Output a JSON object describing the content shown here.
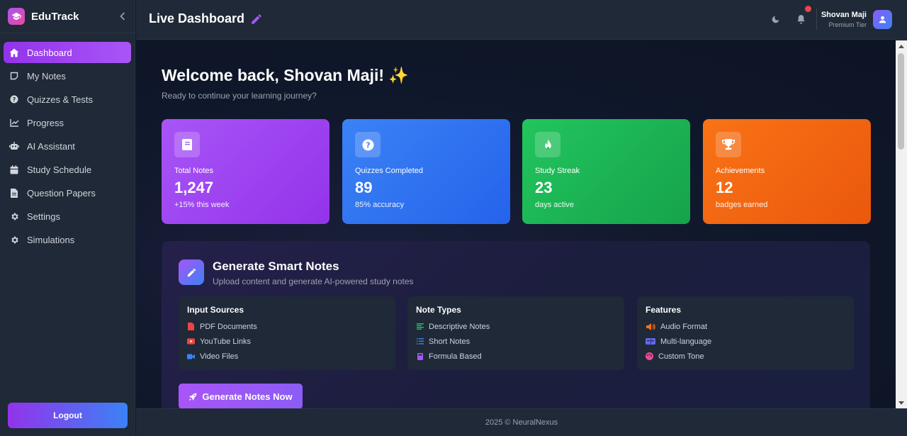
{
  "app": {
    "name": "EduTrack"
  },
  "sidebar": {
    "items": [
      {
        "label": "Dashboard",
        "icon": "home-icon",
        "active": true
      },
      {
        "label": "My Notes",
        "icon": "note-icon"
      },
      {
        "label": "Quizzes & Tests",
        "icon": "question-icon"
      },
      {
        "label": "Progress",
        "icon": "chart-line-icon"
      },
      {
        "label": "AI Assistant",
        "icon": "robot-icon"
      },
      {
        "label": "Study Schedule",
        "icon": "calendar-icon"
      },
      {
        "label": "Question Papers",
        "icon": "file-icon"
      },
      {
        "label": "Settings",
        "icon": "gear-icon"
      },
      {
        "label": "Simulations",
        "icon": "gear-icon"
      }
    ],
    "logout_label": "Logout"
  },
  "header": {
    "title": "Live Dashboard",
    "user_name": "Shovan Maji",
    "user_tier": "Premium Tier"
  },
  "main": {
    "welcome": "Welcome back, Shovan Maji! ✨",
    "subtitle": "Ready to continue your learning journey?",
    "stats": [
      {
        "label": "Total Notes",
        "value": "1,247",
        "sub": "+15% this week",
        "color": "#a855f7"
      },
      {
        "label": "Quizzes Completed",
        "value": "89",
        "sub": "85% accuracy",
        "color": "#3b82f6"
      },
      {
        "label": "Study Streak",
        "value": "23",
        "sub": "days active",
        "color": "#22c55e"
      },
      {
        "label": "Achievements",
        "value": "12",
        "sub": "badges earned",
        "color": "#f97316"
      }
    ],
    "generate": {
      "title": "Generate Smart Notes",
      "subtitle": "Upload content and generate AI-powered study notes",
      "boxes": [
        {
          "title": "Input Sources",
          "items": [
            "PDF Documents",
            "YouTube Links",
            "Video Files"
          ]
        },
        {
          "title": "Note Types",
          "items": [
            "Descriptive Notes",
            "Short Notes",
            "Formula Based"
          ]
        },
        {
          "title": "Features",
          "items": [
            "Audio Format",
            "Multi-language",
            "Custom Tone"
          ]
        }
      ],
      "button_label": "Generate Notes Now"
    }
  },
  "footer": {
    "text": "2025 © NeuralNexus"
  },
  "colors": {
    "accent": "#a855f7",
    "notification": "#ef4444"
  }
}
